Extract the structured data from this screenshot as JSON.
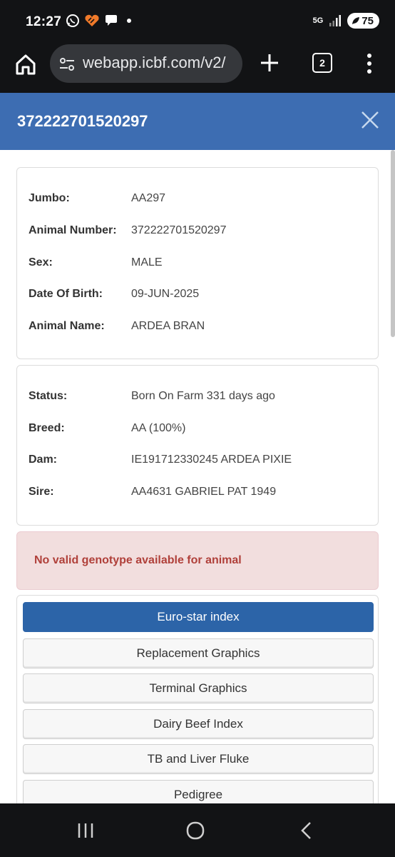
{
  "status_bar": {
    "time": "12:27",
    "network": "5G",
    "battery": "75",
    "icons": [
      "whatsapp-icon",
      "heart-app-icon",
      "chat-icon",
      "notification-dot-icon",
      "signal-icon",
      "battery-icon"
    ]
  },
  "browser": {
    "url": "webapp.icbf.com/v2/",
    "tab_count": "2",
    "icons": [
      "home-icon",
      "tune-icon",
      "plus-icon",
      "tabs-icon",
      "menu-icon"
    ]
  },
  "modal": {
    "title": "372222701520297"
  },
  "identity": [
    {
      "label": "Jumbo:",
      "value": "AA297"
    },
    {
      "label": "Animal Number:",
      "value": "372222701520297"
    },
    {
      "label": "Sex:",
      "value": "MALE"
    },
    {
      "label": "Date Of Birth:",
      "value": "09-JUN-2025"
    },
    {
      "label": "Animal Name:",
      "value": "ARDEA BRAN"
    }
  ],
  "details": [
    {
      "label": "Status:",
      "value": "Born On Farm 331 days ago"
    },
    {
      "label": "Breed:",
      "value": "AA (100%)"
    },
    {
      "label": "Dam:",
      "value": "IE191712330245 ARDEA PIXIE"
    },
    {
      "label": "Sire:",
      "value": "AA4631 GABRIEL PAT 1949"
    }
  ],
  "alert": "No valid genotype available for animal",
  "tabs": [
    {
      "label": "Euro-star index",
      "active": true
    },
    {
      "label": "Replacement Graphics"
    },
    {
      "label": "Terminal Graphics"
    },
    {
      "label": "Dairy Beef Index"
    },
    {
      "label": "TB and Liver Fluke"
    },
    {
      "label": "Pedigree"
    }
  ],
  "colors": {
    "header": "#3d6db2",
    "active_tab": "#2c64a8",
    "alert_bg": "#f2dede",
    "alert_text": "#b0403a"
  }
}
